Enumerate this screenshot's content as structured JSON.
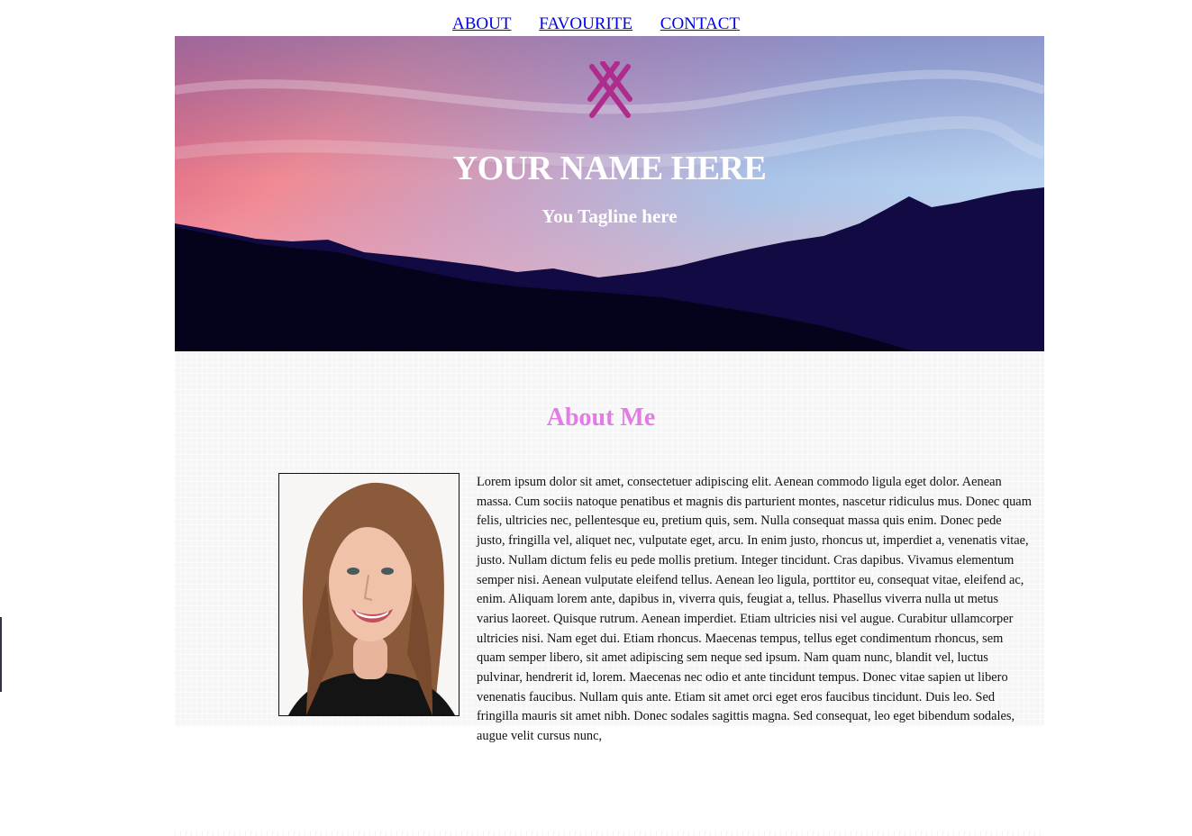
{
  "nav": {
    "items": [
      {
        "label": "ABOUT"
      },
      {
        "label": "FAVOURITE"
      },
      {
        "label": "CONTACT"
      }
    ]
  },
  "hero": {
    "title": "YOUR NAME HERE",
    "tagline": "You Tagline here",
    "logo_icon": "crossed-lines-logo-icon",
    "colors": {
      "logo": "#b02c8c",
      "sky_pink": "#f08a94",
      "sky_blue": "#a9c4e8",
      "mountains": "#0a0630"
    }
  },
  "about": {
    "heading": "About Me",
    "heading_color": "#e27ce3",
    "photo_icon": "portrait-photo",
    "text": "Lorem ipsum dolor sit amet, consectetuer adipiscing elit. Aenean commodo ligula eget dolor. Aenean massa. Cum sociis natoque penatibus et magnis dis parturient montes, nascetur ridiculus mus. Donec quam felis, ultricies nec, pellentesque eu, pretium quis, sem. Nulla consequat massa quis enim. Donec pede justo, fringilla vel, aliquet nec, vulputate eget, arcu. In enim justo, rhoncus ut, imperdiet a, venenatis vitae, justo. Nullam dictum felis eu pede mollis pretium. Integer tincidunt. Cras dapibus. Vivamus elementum semper nisi. Aenean vulputate eleifend tellus. Aenean leo ligula, porttitor eu, consequat vitae, eleifend ac, enim. Aliquam lorem ante, dapibus in, viverra quis, feugiat a, tellus. Phasellus viverra nulla ut metus varius laoreet. Quisque rutrum. Aenean imperdiet. Etiam ultricies nisi vel augue. Curabitur ullamcorper ultricies nisi. Nam eget dui. Etiam rhoncus. Maecenas tempus, tellus eget condimentum rhoncus, sem quam semper libero, sit amet adipiscing sem neque sed ipsum. Nam quam nunc, blandit vel, luctus pulvinar, hendrerit id, lorem. Maecenas nec odio et ante tincidunt tempus. Donec vitae sapien ut libero venenatis faucibus. Nullam quis ante. Etiam sit amet orci eget eros faucibus tincidunt. Duis leo. Sed fringilla mauris sit amet nibh. Donec sodales sagittis magna. Sed consequat, leo eget bibendum sodales, augue velit cursus nunc,"
  }
}
